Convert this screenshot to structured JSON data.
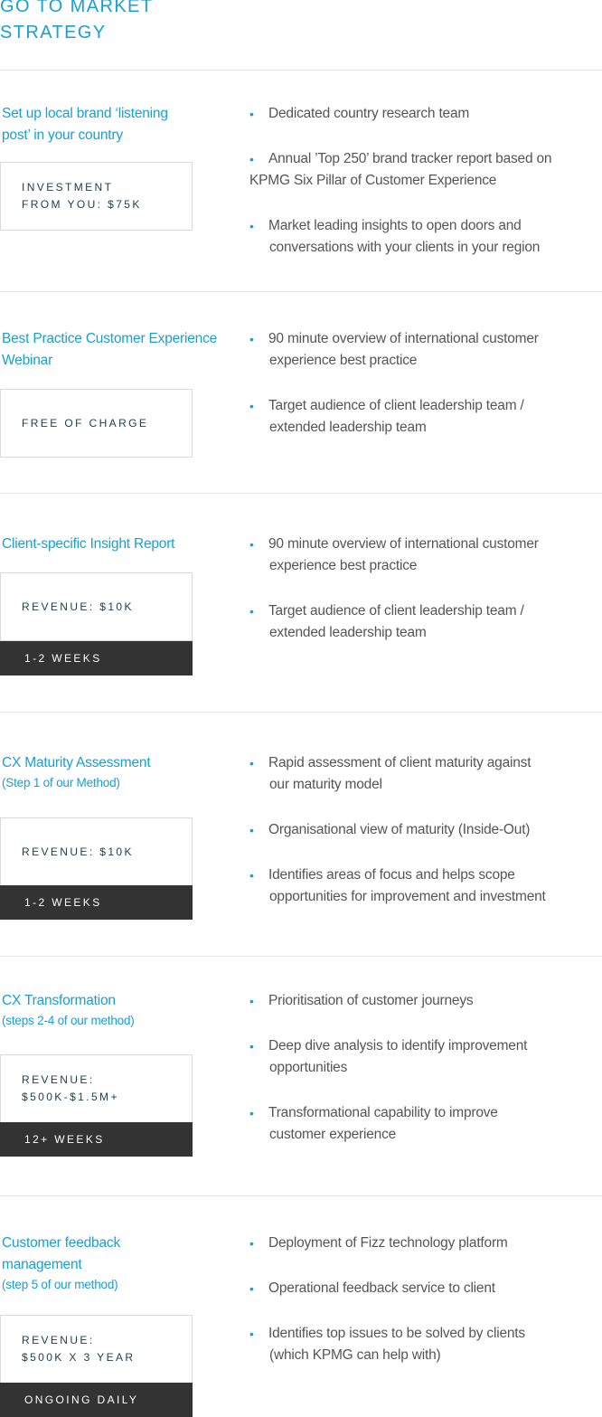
{
  "page": {
    "title_lines": [
      "GO TO MARKET",
      "STRATEGY"
    ]
  },
  "colors": {
    "accent": "#17a0d6",
    "body_text": "#555555",
    "box_text": "#1e4150",
    "box_border": "#d9d9d9",
    "timing_bar": "#333333",
    "divider": "#e6e6e6"
  },
  "sections": [
    {
      "heading": [
        "Set up local brand ‘listening",
        "post’ in your country"
      ],
      "subheading": "",
      "box_lines": [
        "INVESTMENT",
        "FROM YOU: $75K"
      ],
      "timing": "",
      "bullets": [
        [
          "Dedicated country research team"
        ],
        [
          "Annual ’Top 250’ brand tracker report based on",
          "KPMG Six Pillar of Customer Experience"
        ],
        [
          "Market leading insights to open doors and",
          "conversations with your clients in your region"
        ]
      ]
    },
    {
      "heading": [
        "Best Practice Customer Experience",
        "Webinar"
      ],
      "subheading": "",
      "box_lines": [
        "FREE OF CHARGE"
      ],
      "timing": "",
      "bullets": [
        [
          "90 minute overview of international customer",
          "experience best practice"
        ],
        [
          "Target audience of client leadership team /",
          "extended leadership team"
        ]
      ]
    },
    {
      "heading": [
        "Client-specific Insight Report"
      ],
      "subheading": "",
      "box_lines": [
        "REVENUE: $10K"
      ],
      "timing": "1-2 WEEKS",
      "bullets": [
        [
          "90 minute overview of international customer",
          "experience best practice"
        ],
        [
          "Target audience of client leadership team /",
          "extended leadership team"
        ]
      ]
    },
    {
      "heading": [
        "CX Maturity Assessment"
      ],
      "subheading": "(Step 1 of our Method)",
      "box_lines": [
        "REVENUE: $10K"
      ],
      "timing": "1-2 WEEKS",
      "bullets": [
        [
          "Rapid assessment of client maturity against",
          "our maturity model"
        ],
        [
          "Organisational view of maturity (Inside-Out)"
        ],
        [
          "Identifies areas of focus and helps scope",
          "opportunities for improvement and investment"
        ]
      ]
    },
    {
      "heading": [
        "CX Transformation"
      ],
      "subheading": "(steps 2-4 of our method)",
      "box_lines": [
        "REVENUE:",
        "$500K-$1.5M+"
      ],
      "timing": "12+ WEEKS",
      "bullets": [
        [
          "Prioritisation of customer journeys"
        ],
        [
          "Deep dive analysis to identify improvement",
          "opportunities"
        ],
        [
          "Transformational capability to improve",
          "customer experience"
        ]
      ]
    },
    {
      "heading": [
        "Customer feedback",
        "management"
      ],
      "subheading": "(step 5 of our method)",
      "box_lines": [
        "REVENUE:",
        "$500K X 3 YEAR"
      ],
      "timing": "ONGOING DAILY",
      "bullets": [
        [
          "Deployment of Fizz technology platform"
        ],
        [
          "Operational feedback service to client"
        ],
        [
          "Identifies top issues to be solved by clients",
          "(which KPMG can help with)"
        ]
      ]
    }
  ]
}
